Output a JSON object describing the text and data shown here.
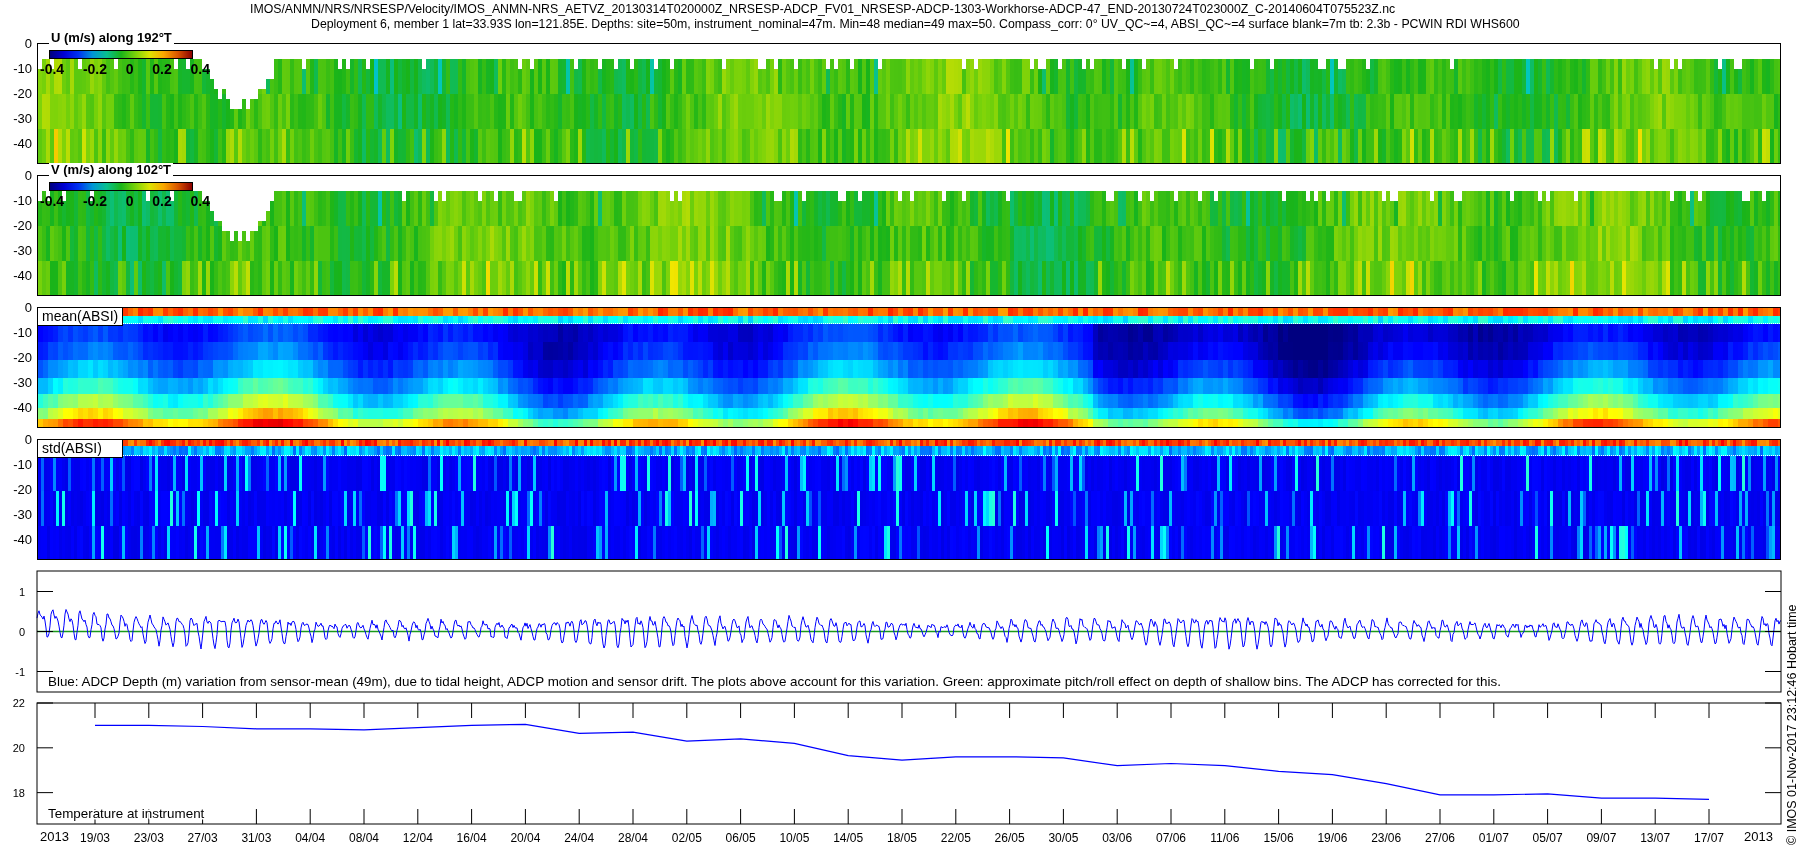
{
  "title": {
    "path": "IMOS/ANMN/NRS/NRSESP/Velocity/IMOS_ANMN-NRS_AETVZ_20130314T020000Z_NRSESP-ADCP_FV01_NRSESP-ADCP-1303-Workhorse-ADCP-47_END-20130724T023000Z_C-20140604T075523Z.nc",
    "subtitle": "Deployment 6, member 1 lat=33.93S lon=121.85E. Depths: site=50m, instrument_nominal=47m. Min=48 median=49 max=50. Compass_corr: 0° UV_QC~=4, ABSI_QC~=4 surface blank=7m tb: 2.3b - PCWIN RDI WHS600"
  },
  "heatmaps": [
    {
      "kind": "velocity",
      "label": "U (m/s) along 192°T",
      "yticks": [
        "0",
        "-10",
        "-20",
        "-30",
        "-40"
      ],
      "colorbar_ticks": [
        "-0.4",
        "-0.2",
        "0",
        "0.2",
        "0.4"
      ]
    },
    {
      "kind": "velocity",
      "label": "V (m/s) along 102°T",
      "yticks": [
        "0",
        "-10",
        "-20",
        "-30",
        "-40"
      ],
      "colorbar_ticks": [
        "-0.4",
        "-0.2",
        "0",
        "0.2",
        "0.4"
      ]
    },
    {
      "kind": "mean",
      "label": "mean(ABSI)",
      "yticks": [
        "0",
        "-10",
        "-20",
        "-30",
        "-40"
      ]
    },
    {
      "kind": "std",
      "label": "std(ABSI)",
      "yticks": [
        "0",
        "-10",
        "-20",
        "-30",
        "-40"
      ]
    }
  ],
  "depth_panel": {
    "yticks": [
      "1",
      "0",
      "-1"
    ],
    "caption": "Blue: ADCP Depth (m) variation from sensor-mean (49m), due to tidal height, ADCP motion and sensor drift. The plots above account for this variation. Green: approximate pitch/roll effect on depth of shallow bins. The ADCP has corrected for this."
  },
  "temperature_panel": {
    "chart_data": {
      "type": "line",
      "title": "Temperature at instrument",
      "categories": [
        "19/03",
        "23/03",
        "27/03",
        "31/03",
        "04/04",
        "08/04",
        "12/04",
        "16/04",
        "20/04",
        "24/04",
        "28/04",
        "02/05",
        "06/05",
        "10/05",
        "14/05",
        "18/05",
        "22/05",
        "26/05",
        "30/05",
        "03/06",
        "07/06",
        "11/06",
        "15/06",
        "19/06",
        "23/06",
        "27/06",
        "01/07",
        "05/07",
        "09/07",
        "13/07",
        "17/07"
      ],
      "series": [
        {
          "color": "#0000ff",
          "values": [
            21.0,
            21.0,
            20.95,
            20.85,
            20.85,
            20.8,
            20.9,
            21.0,
            21.05,
            20.65,
            20.7,
            20.3,
            20.4,
            20.2,
            19.65,
            19.45,
            19.6,
            19.6,
            19.55,
            19.2,
            19.3,
            19.2,
            18.95,
            18.8,
            18.4,
            17.9,
            17.9,
            17.95,
            17.75,
            17.75,
            17.7
          ]
        }
      ],
      "ylim": [
        16.6,
        22
      ],
      "yticks": [
        18,
        20,
        22
      ]
    }
  },
  "year_labels": [
    "2013",
    "2013"
  ],
  "side_note": "© IMOS 01-Nov-2017 23:12:46 Hobart time"
}
